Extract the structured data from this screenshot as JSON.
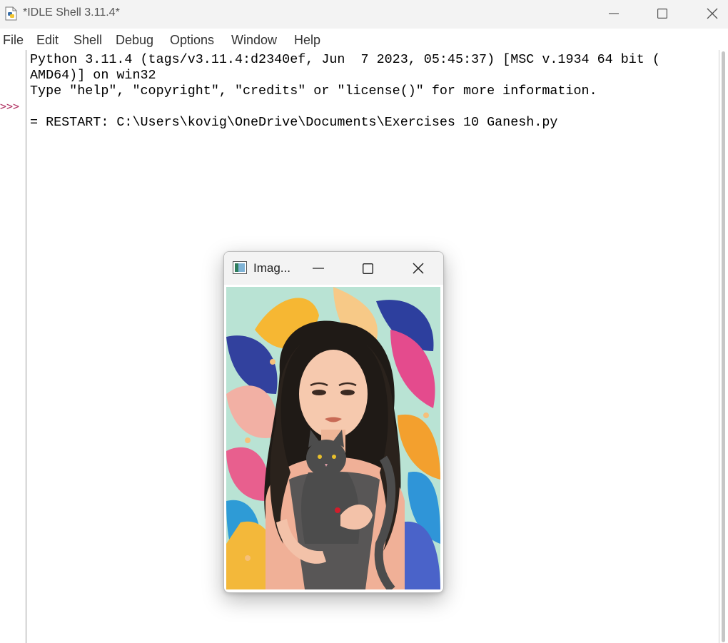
{
  "window": {
    "title": "*IDLE Shell 3.11.4*",
    "icon": "python-file-icon",
    "controls": [
      "minimize-icon",
      "maximize-icon",
      "close-icon"
    ]
  },
  "menu": {
    "items": [
      "File",
      "Edit",
      "Shell",
      "Debug",
      "Options",
      "Window",
      "Help"
    ]
  },
  "shell": {
    "prompt": ">>>",
    "lines": [
      "Python 3.11.4 (tags/v3.11.4:d2340ef, Jun  7 2023, 05:45:37) [MSC v.1934 64 bit (",
      "AMD64)] on win32",
      "Type \"help\", \"copyright\", \"credits\" or \"license()\" for more information.",
      "= RESTART: C:\\Users\\kovig\\OneDrive\\Documents\\Exercises 10 Ganesh.py"
    ],
    "prompt_color": "#b03060"
  },
  "image_window": {
    "title": "Imag...",
    "icon": "image-window-icon",
    "controls": [
      "minimize-icon",
      "maximize-icon",
      "close-icon"
    ],
    "image_subject": "illustration of woman with long dark wavy hair holding a grey cat among tropical leaves"
  }
}
